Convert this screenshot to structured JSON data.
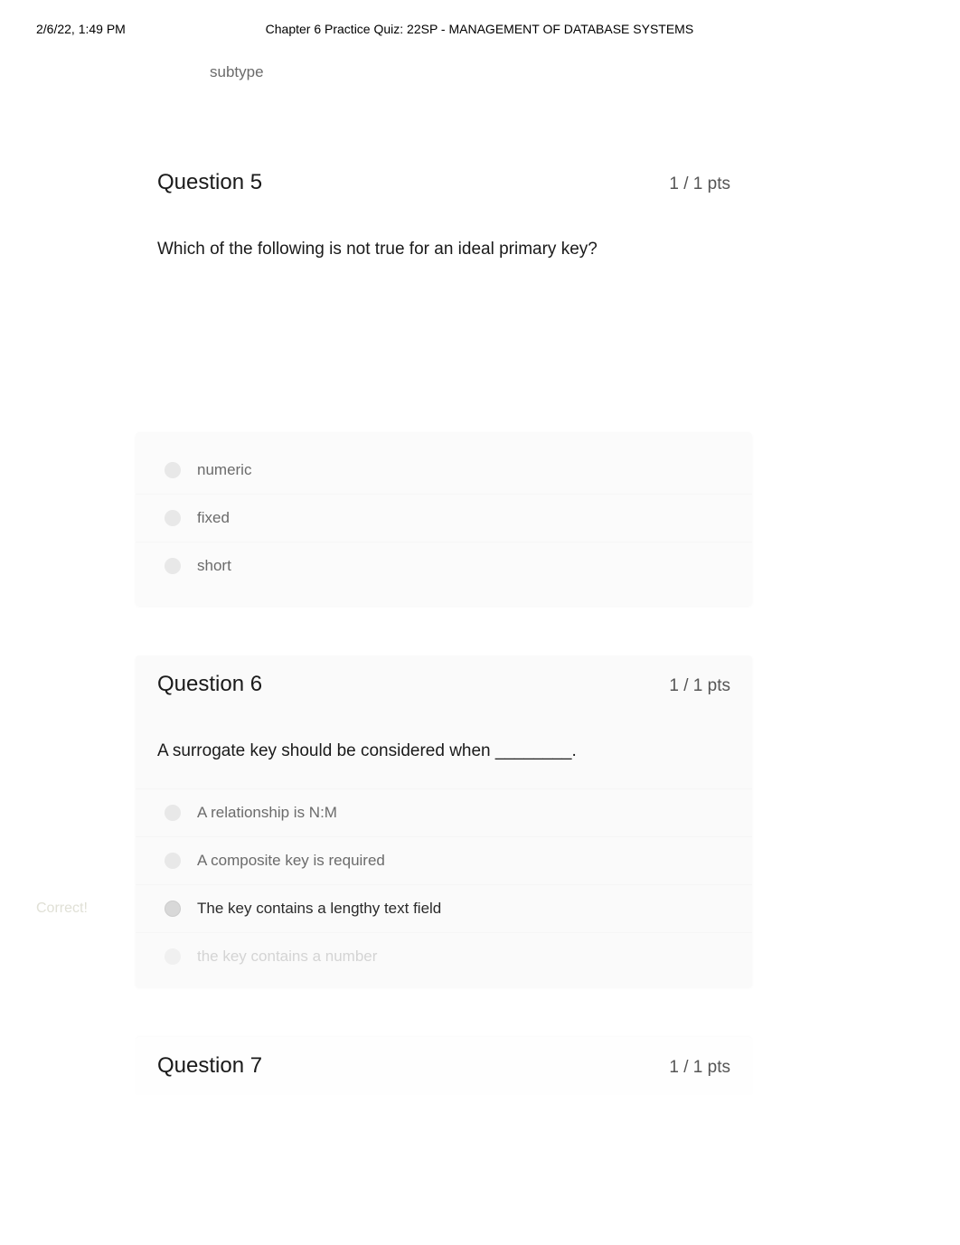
{
  "header": {
    "timestamp": "2/6/22, 1:49 PM",
    "title": "Chapter 6 Practice Quiz: 22SP - MANAGEMENT OF DATABASE SYSTEMS"
  },
  "fragment": {
    "subtype_text": "subtype"
  },
  "question5": {
    "label": "Question 5",
    "points": "1 / 1 pts",
    "prompt": "Which of the following is not true for an ideal primary key?",
    "answers": {
      "a": "numeric",
      "b": "fixed",
      "c": "short"
    }
  },
  "question6": {
    "label": "Question 6",
    "points": "1 / 1 pts",
    "prompt": "A surrogate key should be considered when ________.",
    "correct_label": "Correct!",
    "answers": {
      "a": "A relationship is N:M",
      "b": "A composite key is required",
      "c": "The key contains a lengthy text field",
      "d": "the key contains a number"
    }
  },
  "question7": {
    "label": "Question 7",
    "points": "1 / 1 pts"
  }
}
